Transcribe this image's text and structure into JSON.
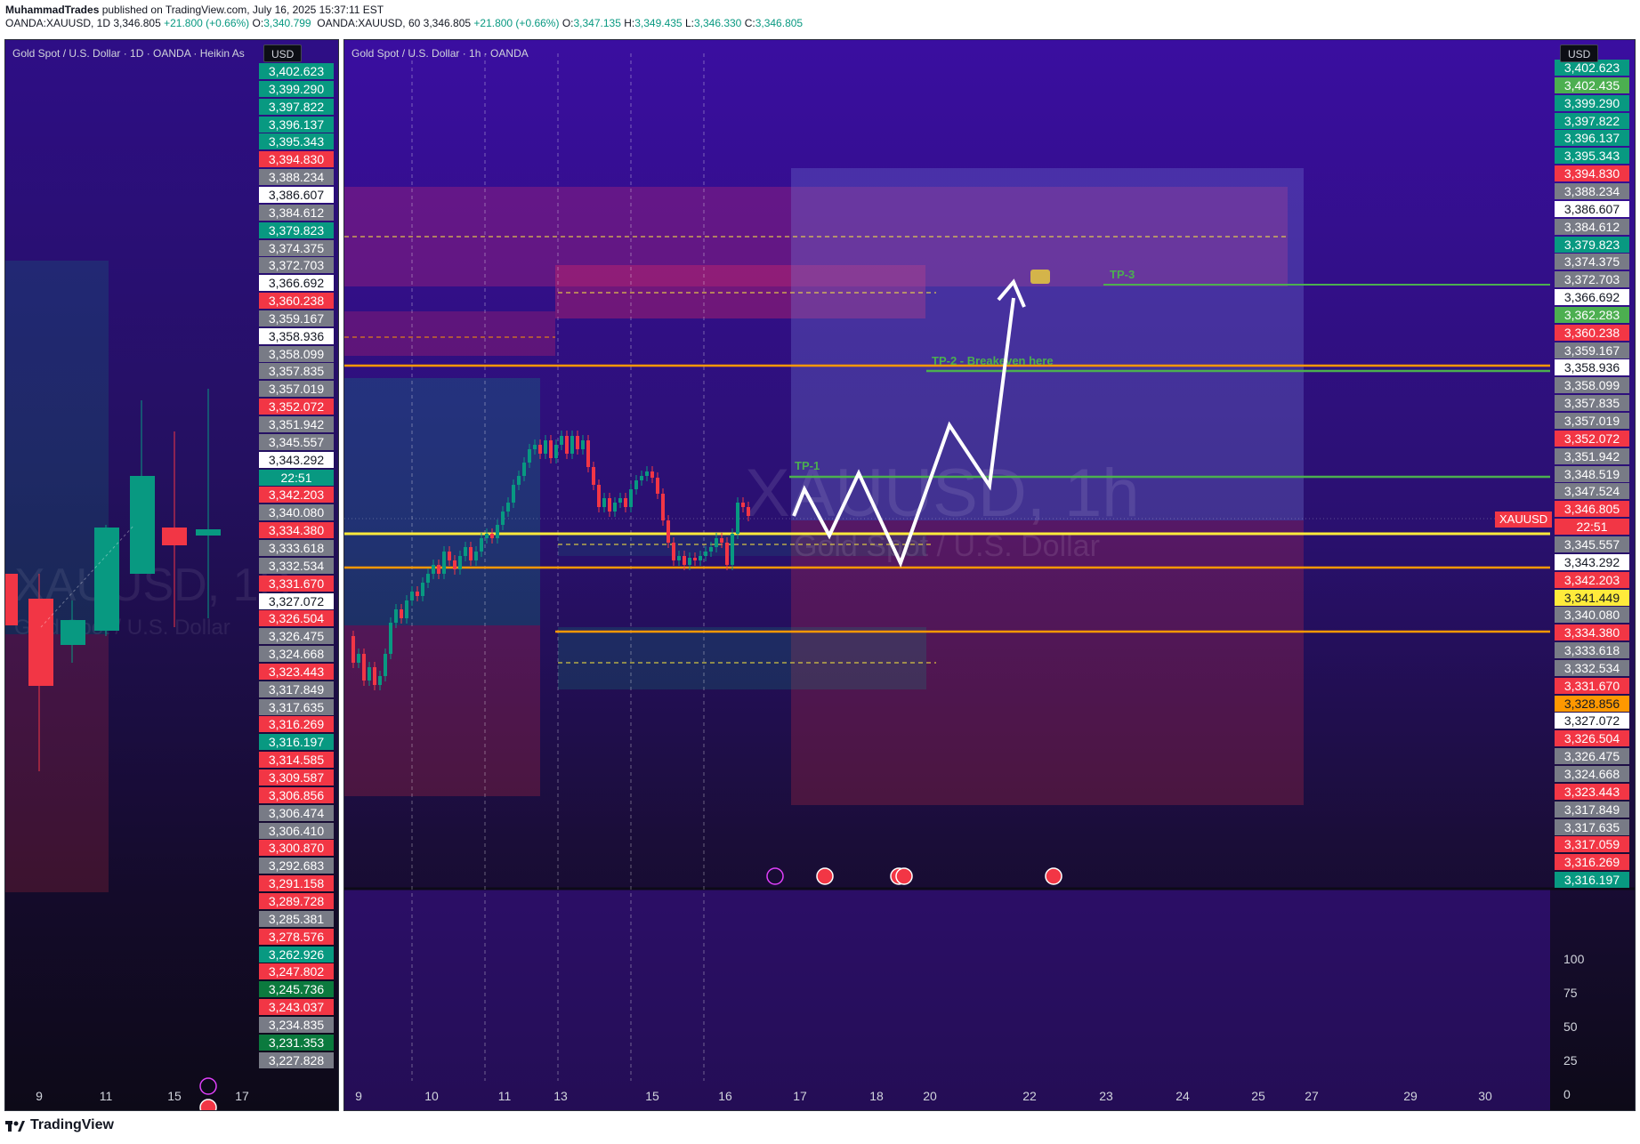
{
  "header": {
    "author": "MuhammadTrades",
    "published": " published on TradingView.com, July 16, 2025 15:37:11 EST",
    "left_symbol": "OANDA:XAUUSD, 1D",
    "left_price": "3,346.805",
    "left_change": "+21.800 (+0.66%)",
    "left_o_label": "O:",
    "left_o": "3,340.799",
    "right_symbol": "OANDA:XAUUSD, 60",
    "right_price": "3,346.805",
    "right_change": "+21.800 (+0.66%)",
    "o_label": "O:",
    "o": "3,347.135",
    "h_label": "H:",
    "h": "3,349.435",
    "l_label": "L:",
    "l": "3,346.330",
    "c_label": "C:",
    "c": "3,346.805"
  },
  "left_panel": {
    "title": "Gold Spot / U.S. Dollar · 1D · OANDA · Heikin As",
    "currency": "USD",
    "watermark_symbol": "XAUUSD, 1D",
    "watermark_name": "Gold Spot / U.S. Dollar",
    "price_labels": [
      {
        "text": "3,402.623",
        "bg": "#089981",
        "fg": "#ffffff"
      },
      {
        "text": "3,399.290",
        "bg": "#089981",
        "fg": "#ffffff"
      },
      {
        "text": "3,397.822",
        "bg": "#089981",
        "fg": "#ffffff"
      },
      {
        "text": "3,396.137",
        "bg": "#089981",
        "fg": "#ffffff"
      },
      {
        "text": "3,395.343",
        "bg": "#089981",
        "fg": "#ffffff"
      },
      {
        "text": "3,394.830",
        "bg": "#f23645",
        "fg": "#ffffff"
      },
      {
        "text": "3,388.234",
        "bg": "#787b86",
        "fg": "#ffffff"
      },
      {
        "text": "3,386.607",
        "bg": "#ffffff",
        "fg": "#131722"
      },
      {
        "text": "3,384.612",
        "bg": "#787b86",
        "fg": "#ffffff"
      },
      {
        "text": "3,379.823",
        "bg": "#089981",
        "fg": "#ffffff"
      },
      {
        "text": "3,374.375",
        "bg": "#787b86",
        "fg": "#ffffff"
      },
      {
        "text": "3,372.703",
        "bg": "#787b86",
        "fg": "#ffffff"
      },
      {
        "text": "3,366.692",
        "bg": "#ffffff",
        "fg": "#131722"
      },
      {
        "text": "3,360.238",
        "bg": "#f23645",
        "fg": "#ffffff"
      },
      {
        "text": "3,359.167",
        "bg": "#787b86",
        "fg": "#ffffff"
      },
      {
        "text": "3,358.936",
        "bg": "#ffffff",
        "fg": "#131722"
      },
      {
        "text": "3,358.099",
        "bg": "#787b86",
        "fg": "#ffffff"
      },
      {
        "text": "3,357.835",
        "bg": "#787b86",
        "fg": "#ffffff"
      },
      {
        "text": "3,357.019",
        "bg": "#787b86",
        "fg": "#ffffff"
      },
      {
        "text": "3,352.072",
        "bg": "#f23645",
        "fg": "#ffffff"
      },
      {
        "text": "3,351.942",
        "bg": "#787b86",
        "fg": "#ffffff"
      },
      {
        "text": "3,345.557",
        "bg": "#787b86",
        "fg": "#ffffff"
      },
      {
        "text": "3,343.292",
        "bg": "#ffffff",
        "fg": "#131722"
      },
      {
        "text": "22:51",
        "bg": "#089981",
        "fg": "#ffffff"
      },
      {
        "text": "3,342.203",
        "bg": "#f23645",
        "fg": "#ffffff"
      },
      {
        "text": "3,340.080",
        "bg": "#787b86",
        "fg": "#ffffff"
      },
      {
        "text": "3,334.380",
        "bg": "#f23645",
        "fg": "#ffffff"
      },
      {
        "text": "3,333.618",
        "bg": "#787b86",
        "fg": "#ffffff"
      },
      {
        "text": "3,332.534",
        "bg": "#787b86",
        "fg": "#ffffff"
      },
      {
        "text": "3,331.670",
        "bg": "#f23645",
        "fg": "#ffffff"
      },
      {
        "text": "3,327.072",
        "bg": "#ffffff",
        "fg": "#131722"
      },
      {
        "text": "3,326.504",
        "bg": "#f23645",
        "fg": "#ffffff"
      },
      {
        "text": "3,326.475",
        "bg": "#787b86",
        "fg": "#ffffff"
      },
      {
        "text": "3,324.668",
        "bg": "#787b86",
        "fg": "#ffffff"
      },
      {
        "text": "3,323.443",
        "bg": "#f23645",
        "fg": "#ffffff"
      },
      {
        "text": "3,317.849",
        "bg": "#787b86",
        "fg": "#ffffff"
      },
      {
        "text": "3,317.635",
        "bg": "#787b86",
        "fg": "#ffffff"
      },
      {
        "text": "3,316.269",
        "bg": "#f23645",
        "fg": "#ffffff"
      },
      {
        "text": "3,316.197",
        "bg": "#089981",
        "fg": "#ffffff"
      },
      {
        "text": "3,314.585",
        "bg": "#f23645",
        "fg": "#ffffff"
      },
      {
        "text": "3,309.587",
        "bg": "#f23645",
        "fg": "#ffffff"
      },
      {
        "text": "3,306.856",
        "bg": "#f23645",
        "fg": "#ffffff"
      },
      {
        "text": "3,306.474",
        "bg": "#787b86",
        "fg": "#ffffff"
      },
      {
        "text": "3,306.410",
        "bg": "#787b86",
        "fg": "#ffffff"
      },
      {
        "text": "3,300.870",
        "bg": "#f23645",
        "fg": "#ffffff"
      },
      {
        "text": "3,292.683",
        "bg": "#787b86",
        "fg": "#ffffff"
      },
      {
        "text": "3,291.158",
        "bg": "#f23645",
        "fg": "#ffffff"
      },
      {
        "text": "3,289.728",
        "bg": "#f23645",
        "fg": "#ffffff"
      },
      {
        "text": "3,285.381",
        "bg": "#787b86",
        "fg": "#ffffff"
      },
      {
        "text": "3,278.576",
        "bg": "#f23645",
        "fg": "#ffffff"
      },
      {
        "text": "3,262.926",
        "bg": "#089981",
        "fg": "#ffffff"
      },
      {
        "text": "3,247.802",
        "bg": "#f23645",
        "fg": "#ffffff"
      },
      {
        "text": "3,245.736",
        "bg": "#0b7a3e",
        "fg": "#ffffff"
      },
      {
        "text": "3,243.037",
        "bg": "#f23645",
        "fg": "#ffffff"
      },
      {
        "text": "3,234.835",
        "bg": "#787b86",
        "fg": "#ffffff"
      },
      {
        "text": "3,231.353",
        "bg": "#0b7a3e",
        "fg": "#ffffff"
      },
      {
        "text": "3,227.828",
        "bg": "#787b86",
        "fg": "#ffffff"
      }
    ],
    "time_labels": [
      "9",
      "11",
      "15",
      "17"
    ]
  },
  "right_panel": {
    "title": "Gold Spot / U.S. Dollar · 1h · OANDA",
    "currency": "USD",
    "watermark_symbol": "XAUUSD, 1h",
    "watermark_name": "Gold Spot / U.S. Dollar",
    "symbol_tag": "XAUUSD",
    "tp1": "TP-1",
    "tp2": "TP-2 - Breakeven here",
    "tp3": "TP-3",
    "price_labels": [
      {
        "text": "3,402.623",
        "bg": "#089981",
        "fg": "#ffffff"
      },
      {
        "text": "3,402.435",
        "bg": "#4caf50",
        "fg": "#ffffff"
      },
      {
        "text": "3,399.290",
        "bg": "#089981",
        "fg": "#ffffff"
      },
      {
        "text": "3,397.822",
        "bg": "#089981",
        "fg": "#ffffff"
      },
      {
        "text": "3,396.137",
        "bg": "#089981",
        "fg": "#ffffff"
      },
      {
        "text": "3,395.343",
        "bg": "#089981",
        "fg": "#ffffff"
      },
      {
        "text": "3,394.830",
        "bg": "#f23645",
        "fg": "#ffffff"
      },
      {
        "text": "3,388.234",
        "bg": "#787b86",
        "fg": "#ffffff"
      },
      {
        "text": "3,386.607",
        "bg": "#ffffff",
        "fg": "#131722"
      },
      {
        "text": "3,384.612",
        "bg": "#787b86",
        "fg": "#ffffff"
      },
      {
        "text": "3,379.823",
        "bg": "#089981",
        "fg": "#ffffff"
      },
      {
        "text": "3,374.375",
        "bg": "#787b86",
        "fg": "#ffffff"
      },
      {
        "text": "3,372.703",
        "bg": "#787b86",
        "fg": "#ffffff"
      },
      {
        "text": "3,366.692",
        "bg": "#ffffff",
        "fg": "#131722"
      },
      {
        "text": "3,362.283",
        "bg": "#4caf50",
        "fg": "#ffffff"
      },
      {
        "text": "3,360.238",
        "bg": "#f23645",
        "fg": "#ffffff"
      },
      {
        "text": "3,359.167",
        "bg": "#787b86",
        "fg": "#ffffff"
      },
      {
        "text": "3,358.936",
        "bg": "#ffffff",
        "fg": "#131722"
      },
      {
        "text": "3,358.099",
        "bg": "#787b86",
        "fg": "#ffffff"
      },
      {
        "text": "3,357.835",
        "bg": "#787b86",
        "fg": "#ffffff"
      },
      {
        "text": "3,357.019",
        "bg": "#787b86",
        "fg": "#ffffff"
      },
      {
        "text": "3,352.072",
        "bg": "#f23645",
        "fg": "#ffffff"
      },
      {
        "text": "3,351.942",
        "bg": "#787b86",
        "fg": "#ffffff"
      },
      {
        "text": "3,348.519",
        "bg": "#787b86",
        "fg": "#ffffff"
      },
      {
        "text": "3,347.524",
        "bg": "#787b86",
        "fg": "#ffffff"
      },
      {
        "text": "3,346.805",
        "bg": "#f23645",
        "fg": "#ffffff"
      },
      {
        "text": "22:51",
        "bg": "#f23645",
        "fg": "#ffffff"
      },
      {
        "text": "3,345.557",
        "bg": "#787b86",
        "fg": "#ffffff"
      },
      {
        "text": "3,343.292",
        "bg": "#ffffff",
        "fg": "#131722"
      },
      {
        "text": "3,342.203",
        "bg": "#f23645",
        "fg": "#ffffff"
      },
      {
        "text": "3,341.449",
        "bg": "#ffeb3b",
        "fg": "#131722"
      },
      {
        "text": "3,340.080",
        "bg": "#787b86",
        "fg": "#ffffff"
      },
      {
        "text": "3,334.380",
        "bg": "#f23645",
        "fg": "#ffffff"
      },
      {
        "text": "3,333.618",
        "bg": "#787b86",
        "fg": "#ffffff"
      },
      {
        "text": "3,332.534",
        "bg": "#787b86",
        "fg": "#ffffff"
      },
      {
        "text": "3,331.670",
        "bg": "#f23645",
        "fg": "#ffffff"
      },
      {
        "text": "3,328.856",
        "bg": "#ff9800",
        "fg": "#131722"
      },
      {
        "text": "3,327.072",
        "bg": "#ffffff",
        "fg": "#131722"
      },
      {
        "text": "3,326.504",
        "bg": "#f23645",
        "fg": "#ffffff"
      },
      {
        "text": "3,326.475",
        "bg": "#787b86",
        "fg": "#ffffff"
      },
      {
        "text": "3,324.668",
        "bg": "#787b86",
        "fg": "#ffffff"
      },
      {
        "text": "3,323.443",
        "bg": "#f23645",
        "fg": "#ffffff"
      },
      {
        "text": "3,317.849",
        "bg": "#787b86",
        "fg": "#ffffff"
      },
      {
        "text": "3,317.635",
        "bg": "#787b86",
        "fg": "#ffffff"
      },
      {
        "text": "3,317.059",
        "bg": "#f23645",
        "fg": "#ffffff"
      },
      {
        "text": "3,316.269",
        "bg": "#f23645",
        "fg": "#ffffff"
      },
      {
        "text": "3,316.197",
        "bg": "#089981",
        "fg": "#ffffff"
      }
    ],
    "oscillator_labels": [
      "100",
      "75",
      "50",
      "25",
      "0"
    ],
    "time_labels": [
      "9",
      "10",
      "11",
      "13",
      "15",
      "16",
      "17",
      "18",
      "20",
      "22",
      "23",
      "24",
      "25",
      "27",
      "29",
      "30"
    ]
  },
  "footer": {
    "brand": "TradingView"
  },
  "colors": {
    "panel_bg_top": "#3a0ea0",
    "panel_bg_bottom": "#0d0a18",
    "support_yellow": "#ffeb3b",
    "level_orange": "#ff9800",
    "tp_green": "#4caf50",
    "path_white": "#ffffff",
    "bull": "#089981",
    "bear": "#f23645"
  }
}
